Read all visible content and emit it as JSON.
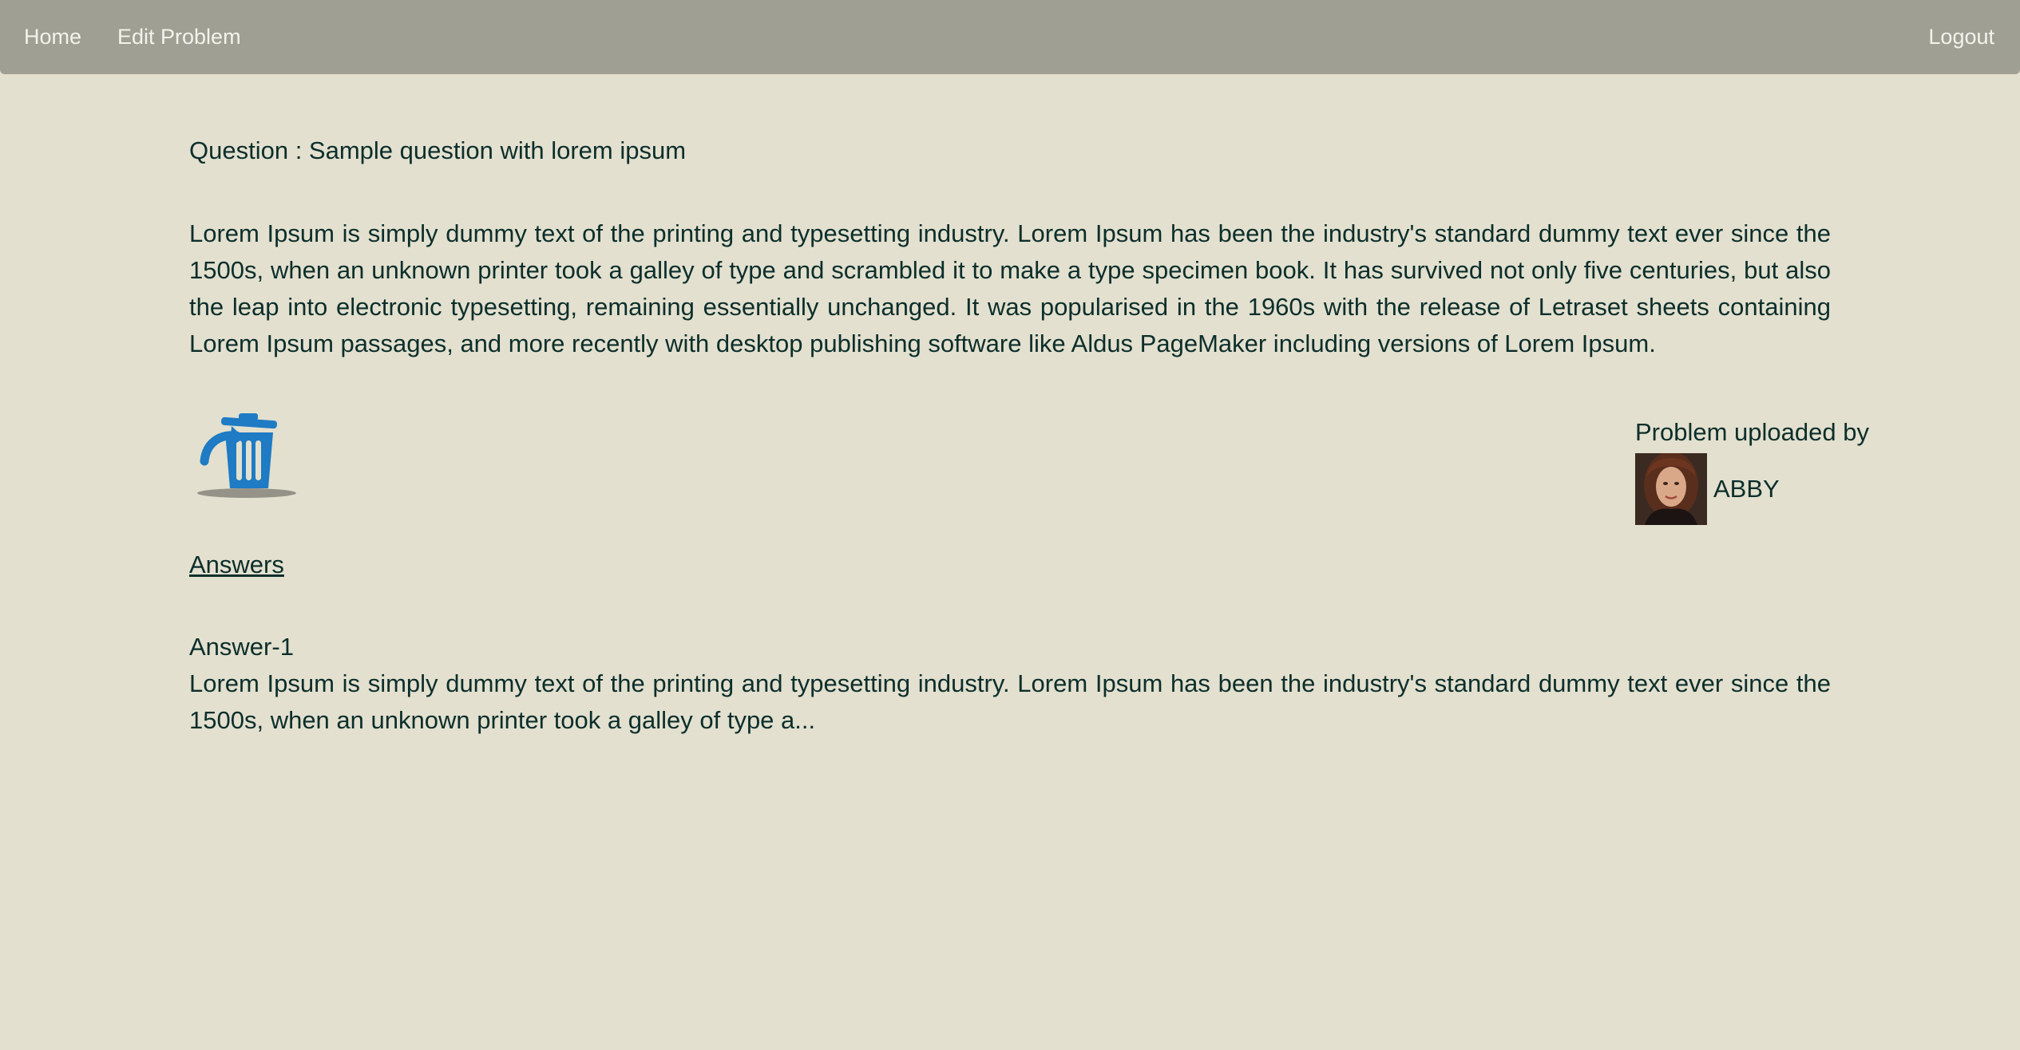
{
  "nav": {
    "home": "Home",
    "edit_problem": "Edit Problem",
    "logout": "Logout"
  },
  "question": {
    "title": "Question : Sample question with lorem ipsum",
    "body": "Lorem Ipsum is simply dummy text of the printing and typesetting industry. Lorem Ipsum has been the industry's standard dummy text ever since the 1500s, when an unknown printer took a galley of type and scrambled it to make a type specimen book. It has survived not only five centuries, but also the leap into electronic typesetting, remaining essentially unchanged. It was popularised in the 1960s with the release of Letraset sheets containing Lorem Ipsum passages, and more recently with desktop publishing software like Aldus PageMaker including versions of Lorem Ipsum."
  },
  "icons": {
    "delete": "trash-icon"
  },
  "uploader": {
    "label": "Problem uploaded by",
    "name": "ABBY"
  },
  "answers": {
    "heading": "Answers",
    "items": [
      {
        "title": "Answer-1",
        "excerpt": "Lorem Ipsum is simply dummy text of the printing and typesetting industry. Lorem Ipsum has been the industry's standard dummy text ever since the 1500s, when an unknown printer took a galley of type a..."
      }
    ]
  },
  "colors": {
    "background": "#e3e0cf",
    "navbar": "#a09f93",
    "nav_text": "#f4f3ea",
    "text": "#0c2e2b",
    "trash_icon": "#1e7bc4"
  }
}
